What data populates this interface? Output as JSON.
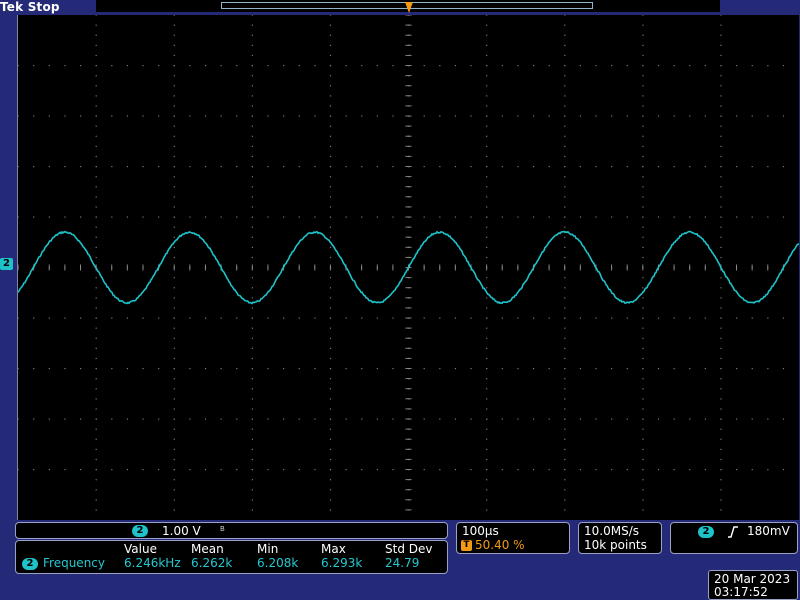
{
  "header": {
    "brand": "Tek",
    "status": "Stop"
  },
  "channel": {
    "number": "2",
    "scale": "1.00 V",
    "bandwidth_icon": "B_W",
    "color": "#1ec2c9"
  },
  "trigger": {
    "marker": "T",
    "position": "50.40 %",
    "slope_icon": "rising-edge",
    "level": "180mV",
    "channel": "2",
    "color": "#f39a16"
  },
  "timebase": {
    "scale": "100µs",
    "sample_rate": "10.0MS/s",
    "record_length": "10k points"
  },
  "measurements": {
    "channel": "2",
    "name": "Frequency",
    "headers": [
      "Value",
      "Mean",
      "Min",
      "Max",
      "Std Dev"
    ],
    "values": [
      "6.246kHz",
      "6.262k",
      "6.208k",
      "6.293k",
      "24.79"
    ]
  },
  "datetime": {
    "date": "20 Mar  2023",
    "time": "03:17:52"
  },
  "waveform": {
    "frequency_hz": 6246,
    "amplitude_div": 0.7,
    "phase_zero_at_center": true
  }
}
